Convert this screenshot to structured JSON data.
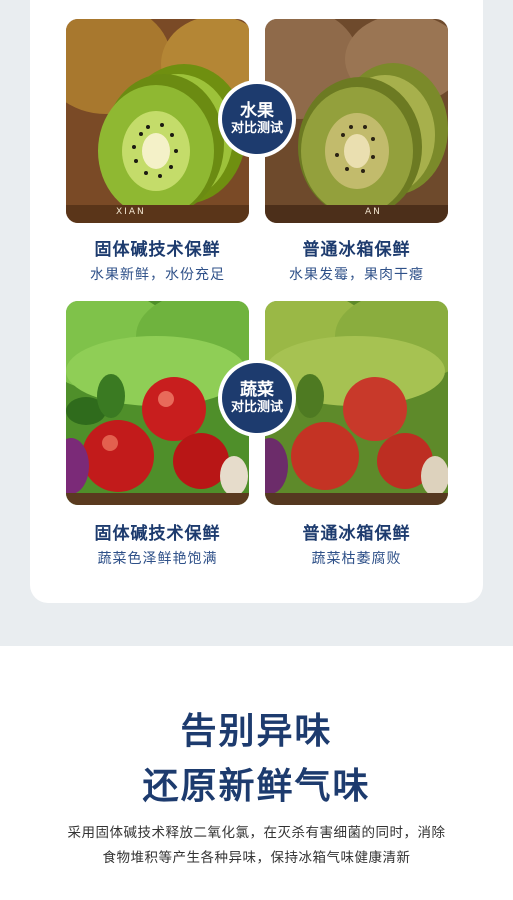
{
  "fruit": {
    "badge": {
      "line1": "水果",
      "line2": "对比测试"
    },
    "left": {
      "title": "固体碱技术保鲜",
      "subtitle": "水果新鲜，水份充足",
      "watermark": "XIAN"
    },
    "right": {
      "title": "普通冰箱保鲜",
      "subtitle": "水果发霉，果肉干瘪",
      "watermark": "AN"
    }
  },
  "veg": {
    "badge": {
      "line1": "蔬菜",
      "line2": "对比测试"
    },
    "left": {
      "title": "固体碱技术保鲜",
      "subtitle": "蔬菜色泽鲜艳饱满"
    },
    "right": {
      "title": "普通冰箱保鲜",
      "subtitle": "蔬菜枯萎腐败"
    }
  },
  "section": {
    "headline1": "告别异味",
    "headline2": "还原新鲜气味",
    "desc1": "采用固体碱技术释放二氧化氯，在灭杀有害细菌的同时，消除",
    "desc2": "食物堆积等产生各种异味，保持冰箱气味健康清新"
  },
  "colors": {
    "navy": "#1d3b6e",
    "band": "#e9edf0"
  }
}
